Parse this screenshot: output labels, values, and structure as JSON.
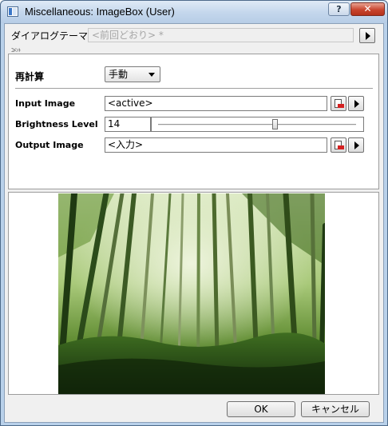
{
  "window": {
    "title": "Miscellaneous: ImageBox (User)",
    "help_label": "?",
    "close_label": "✕"
  },
  "theme": {
    "label": "ダイアログテーマ",
    "value": "<前回どおり> *"
  },
  "tiny_label": "ｺﾒﾝﾄ",
  "settings": {
    "recalc": {
      "label": "再計算",
      "value": "手動"
    },
    "input_image": {
      "label": "Input Image",
      "value": "<active>"
    },
    "brightness": {
      "label": "Brightness Level",
      "value": "14",
      "slider_fraction": 0.59
    },
    "output_image": {
      "label": "Output Image",
      "value": "<入力>"
    }
  },
  "buttons": {
    "ok": "OK",
    "cancel": "キャンセル"
  },
  "colors": {
    "titlebar": "#c3d6ec",
    "close": "#c9452e",
    "dialog_bg": "#f0f0f0"
  }
}
